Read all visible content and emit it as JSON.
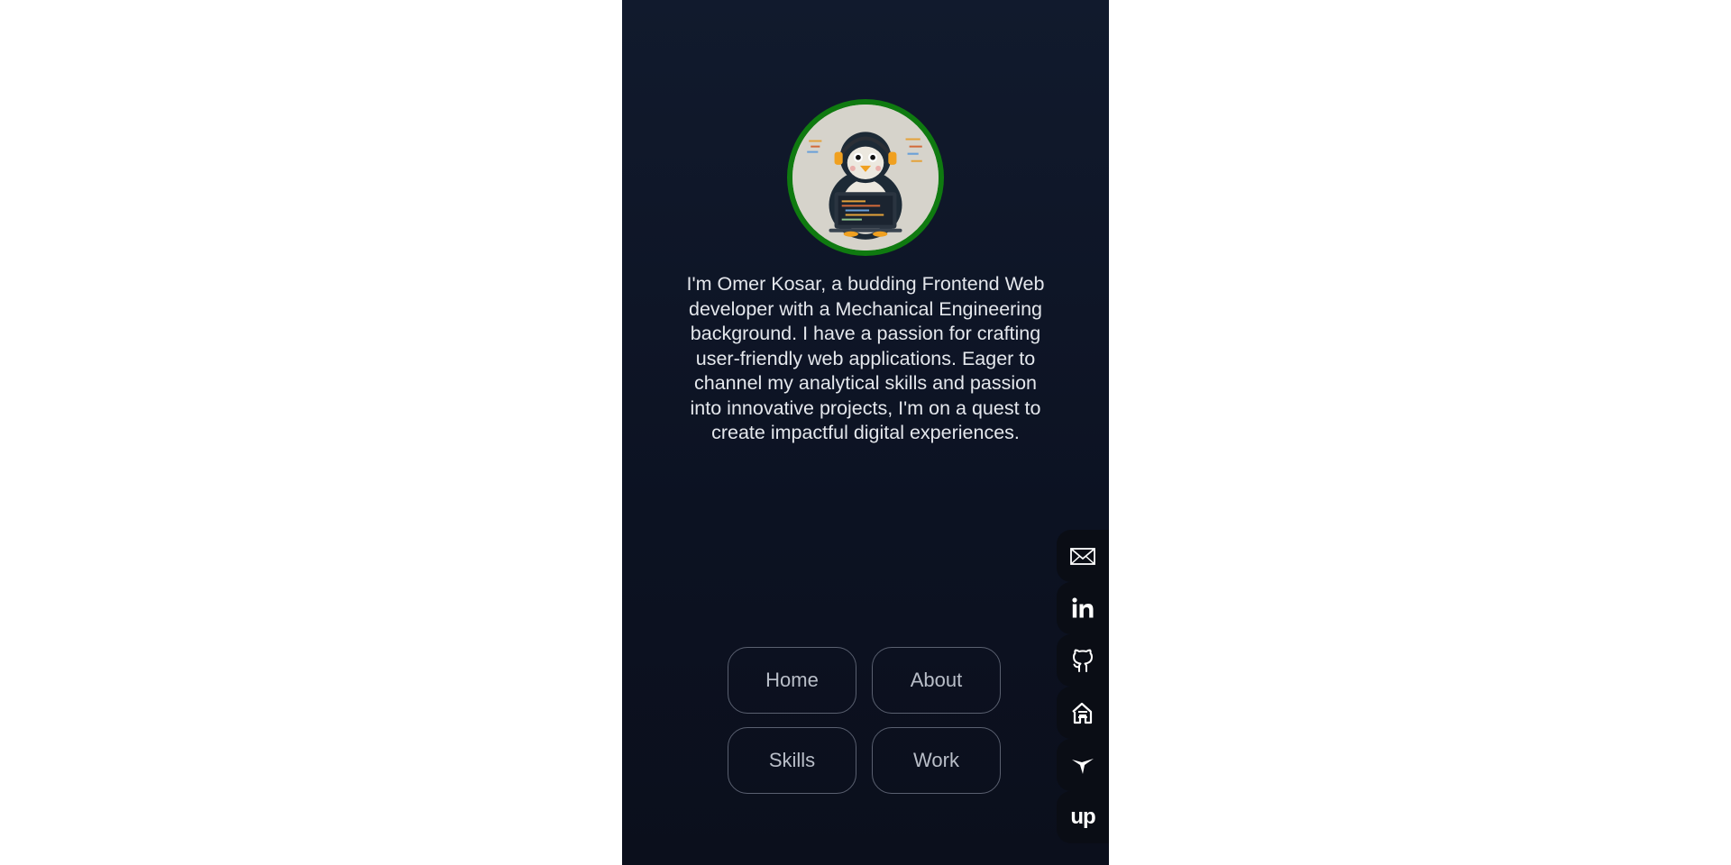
{
  "profile": {
    "avatar_alt": "penguin-coder-avatar",
    "bio": "I'm Omer Kosar, a budding Frontend Web developer with a Mechanical Engineering background. I have a passion for crafting user-friendly web applications. Eager to channel my analytical skills and passion into innovative projects, I'm on a quest to create impactful digital experiences."
  },
  "nav": {
    "home": "Home",
    "about": "About",
    "skills": "Skills",
    "work": "Work"
  },
  "social": [
    "mail-icon",
    "linkedin-icon",
    "github-icon",
    "hashnode-icon",
    "hummingbird-icon",
    "upwork-icon"
  ],
  "colors": {
    "panel_bg": "#0f1627",
    "avatar_ring": "#0f7a10",
    "text": "#e4e7ec",
    "nav_border": "#5a6070"
  }
}
